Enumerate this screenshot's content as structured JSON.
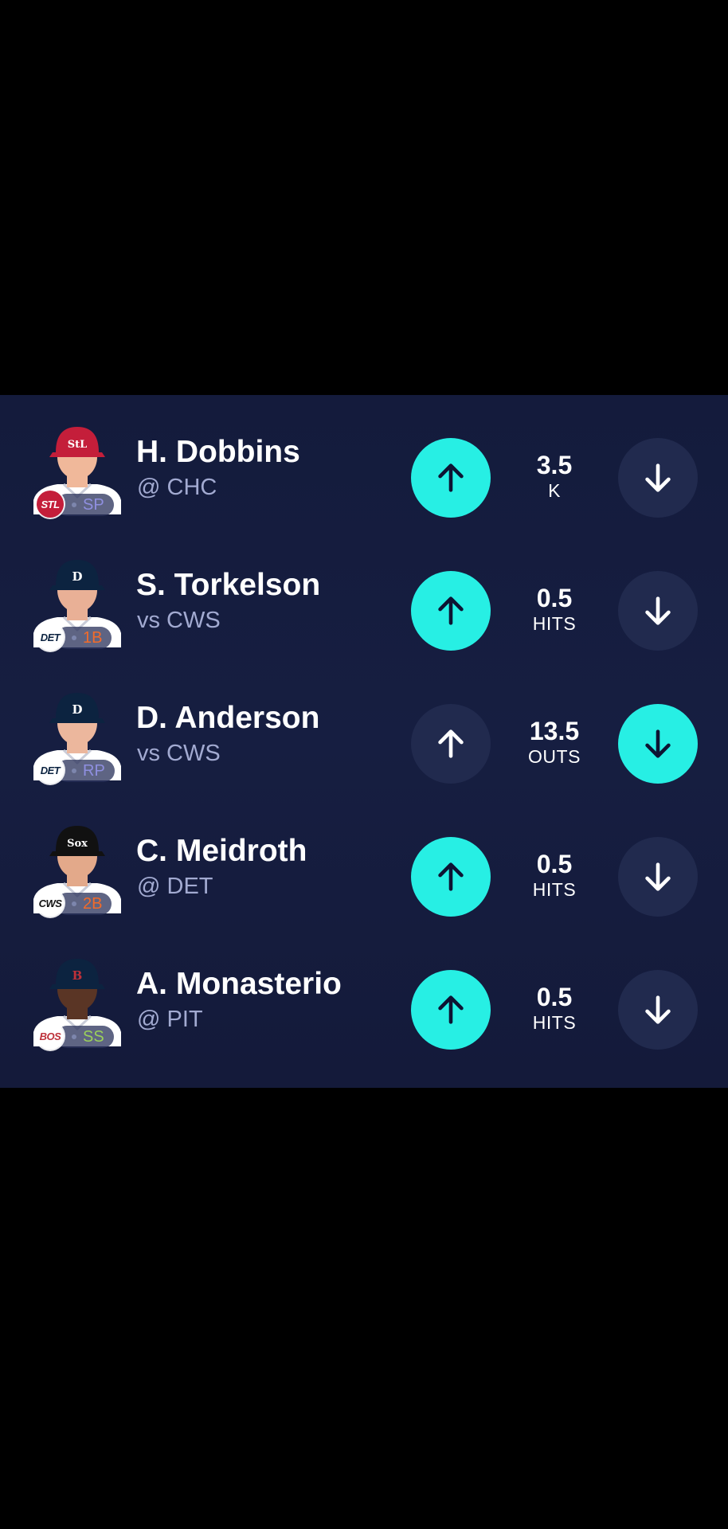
{
  "colors": {
    "accent": "#27efe4",
    "panel_bg": "#151c3e",
    "inactive_button": "#212a4e",
    "subtext": "#a2aad1"
  },
  "players": [
    {
      "name": "H. Dobbins",
      "matchup": "@ CHC",
      "team": "STL",
      "team_color": "#c41e3a",
      "team_text_color": "#ffffff",
      "position": "SP",
      "position_color": "#8f8fe0",
      "cap_color": "#c41e3a",
      "cap_logo": "StL",
      "jersey_color": "#ffffff",
      "skin_color": "#f0b89a",
      "stat_value": "3.5",
      "stat_label": "K",
      "selected": "none"
    },
    {
      "name": "S. Torkelson",
      "matchup": "vs CWS",
      "team": "DET",
      "team_color": "#ffffff",
      "team_text_color": "#0c2340",
      "position": "1B",
      "position_color": "#f26b2a",
      "cap_color": "#0c2340",
      "cap_logo": "D",
      "jersey_color": "#ffffff",
      "skin_color": "#e9b096",
      "stat_value": "0.5",
      "stat_label": "HITS",
      "selected": "none"
    },
    {
      "name": "D. Anderson",
      "matchup": "vs CWS",
      "team": "DET",
      "team_color": "#ffffff",
      "team_text_color": "#0c2340",
      "position": "RP",
      "position_color": "#8f8fe0",
      "cap_color": "#0c2340",
      "cap_logo": "D",
      "jersey_color": "#ffffff",
      "skin_color": "#ecb79d",
      "stat_value": "13.5",
      "stat_label": "OUTS",
      "selected": "down"
    },
    {
      "name": "C. Meidroth",
      "matchup": "@ DET",
      "team": "CWS",
      "team_color": "#ffffff",
      "team_text_color": "#111111",
      "position": "2B",
      "position_color": "#f26b2a",
      "cap_color": "#111111",
      "cap_logo": "Sox",
      "jersey_color": "#ffffff",
      "skin_color": "#e3a98a",
      "stat_value": "0.5",
      "stat_label": "HITS",
      "selected": "none"
    },
    {
      "name": "A. Monasterio",
      "matchup": "@ PIT",
      "team": "BOS",
      "team_color": "#ffffff",
      "team_text_color": "#bd3039",
      "position": "SS",
      "position_color": "#9bd15a",
      "cap_color": "#0c2340",
      "cap_logo": "B",
      "jersey_color": "#ffffff",
      "skin_color": "#5a3525",
      "stat_value": "0.5",
      "stat_label": "HITS",
      "selected": "none"
    }
  ]
}
